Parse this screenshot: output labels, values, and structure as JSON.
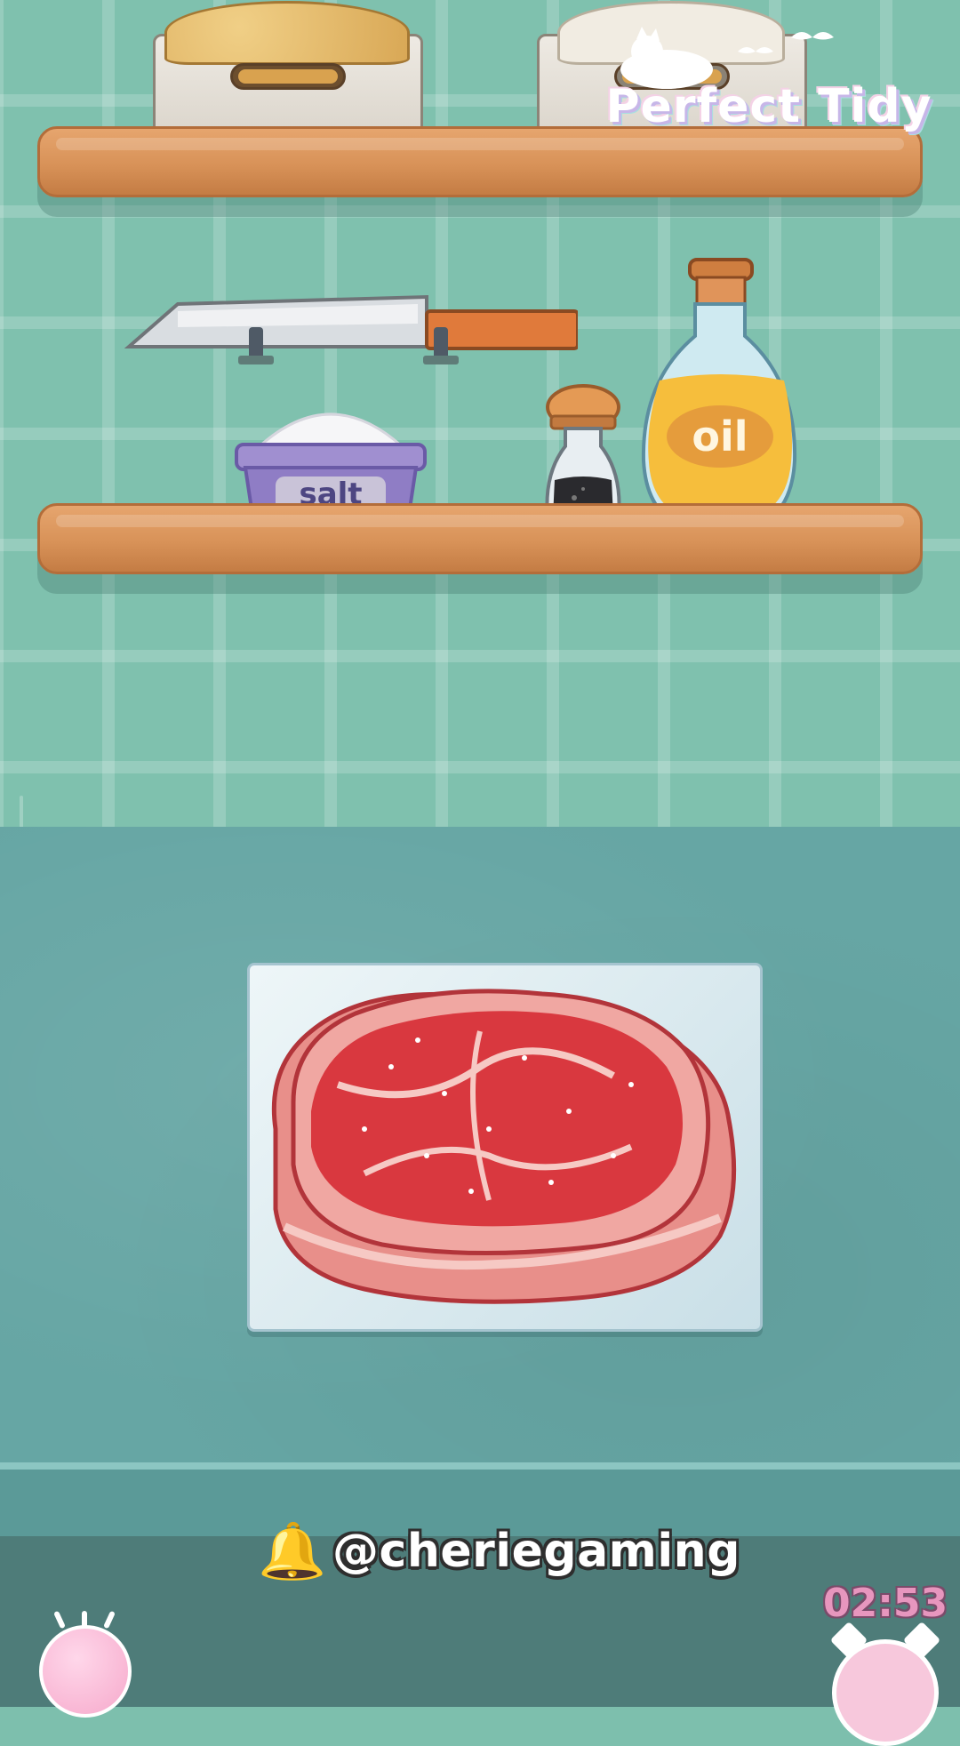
{
  "game": {
    "logo_text": "Perfect Tidy",
    "watermark": {
      "icon": "bell-icon",
      "handle": "@cheriegaming"
    },
    "timer": "02:53"
  },
  "items": {
    "salt_label": "salt",
    "oil_label": "oil",
    "knife": "knife",
    "pepper": "pepper-shaker",
    "steak": "raw-steak"
  },
  "colors": {
    "wall": "#7fc1ae",
    "counter": "#66a6a4",
    "shelf": "#d89258",
    "timer": "#e796be"
  }
}
